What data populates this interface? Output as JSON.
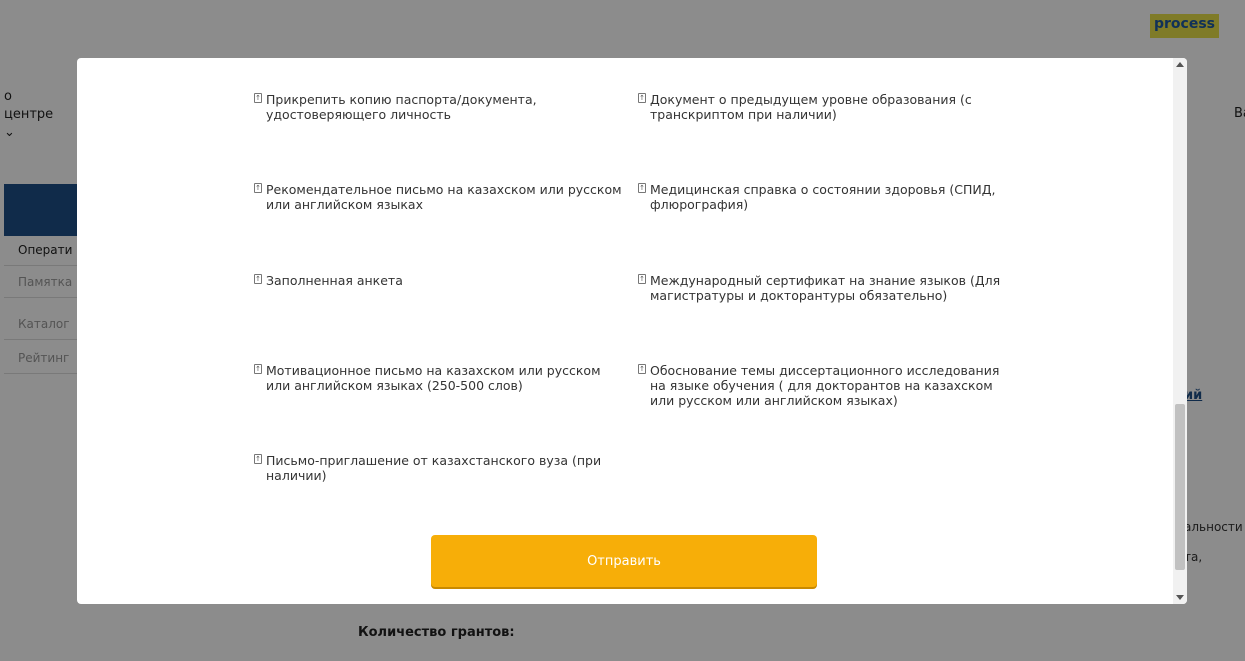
{
  "background": {
    "logo_text": "process",
    "nav_left_lines": [
      "о",
      "центре",
      "⌄"
    ],
    "nav_right_text": "Ва",
    "sidebar_items": [
      "Операти",
      "Памятка",
      "Каталог",
      "Рейтинг"
    ],
    "link_text": "ий",
    "text_right_1": "альности",
    "text_right_2": "та,",
    "grants_label": "Количество грантов:"
  },
  "modal": {
    "documents_left": [
      "Прикрепить копию паспорта/документа, удостоверяющего личность",
      "Рекомендательное письмо на казахском или русском или английском языках",
      "Заполненная анкета",
      "Мотивационное письмо на казахском или русском или английском языках (250-500 слов)",
      "Письмо-приглашение от казахстанского вуза (при наличии)"
    ],
    "documents_right": [
      "Документ о предыдущем уровне образования (с транскриптом при наличии)",
      "Медицинская справка о состоянии здоровья (СПИД, флюрография)",
      "Международный сертификат на знание языков (Для магистратуры и докторантуры обязательно)",
      "Обоснование темы диссертационного исследования на языке обучения ( для докторантов на казахском или русском или английском языках)"
    ],
    "submit_label": "Отправить",
    "icon_glyph": "↑"
  },
  "colors": {
    "submit": "#f7ae08",
    "sidebar_head": "#1e4f87",
    "overlay": "rgba(0,0,0,0.45)"
  }
}
